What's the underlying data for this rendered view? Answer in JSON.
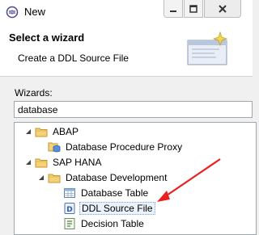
{
  "window": {
    "title": "New",
    "icon": "eclipse-new-wizard-icon"
  },
  "title_buttons": [
    {
      "icon": "minimize-icon"
    },
    {
      "icon": "maximize-icon"
    },
    {
      "icon": "close-icon"
    }
  ],
  "banner": {
    "title": "Select a wizard",
    "subtitle": "Create a DDL Source File",
    "graphic": "new-wizard-banner-icon"
  },
  "wizards": {
    "label": "Wizards:",
    "filter_value": "database"
  },
  "tree": [
    {
      "label": "ABAP",
      "icon": "folder-icon",
      "expanded": true
    },
    {
      "label": "Database Procedure Proxy",
      "icon": "database-procedure-proxy-icon"
    },
    {
      "label": "SAP HANA",
      "icon": "folder-icon",
      "expanded": true
    },
    {
      "label": "Database Development",
      "icon": "folder-icon",
      "expanded": true
    },
    {
      "label": "Database Table",
      "icon": "table-icon"
    },
    {
      "label": "DDL Source File",
      "icon": "ddl-source-icon",
      "selected": true
    },
    {
      "label": "Decision Table",
      "icon": "decision-table-icon"
    }
  ],
  "annotation": {
    "icon": "red-arrow-icon",
    "color": "#e8201f"
  },
  "colors": {
    "selection_border": "#7aa7d8",
    "folder": "#e6b94c",
    "frame_border": "#9fa6ad"
  }
}
